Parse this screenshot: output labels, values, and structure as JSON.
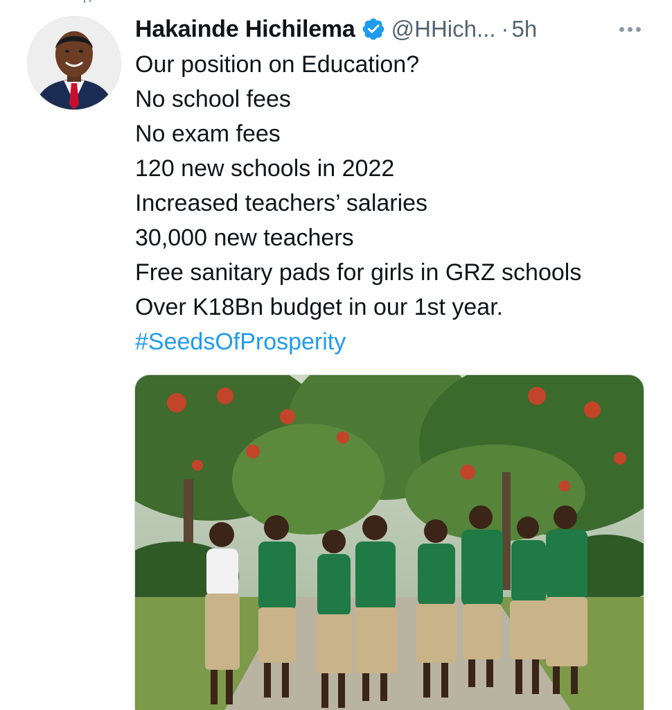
{
  "tweet": {
    "author_name": "Hakainde Hichilema",
    "handle": "@HHich...",
    "separator": "·",
    "time": "5h",
    "lines": [
      "Our position on Education?",
      "No school fees",
      "No exam fees",
      "120 new schools in 2022",
      "Increased teachers’ salaries",
      "30,000 new teachers",
      "Free sanitary pads for girls in GRZ schools",
      "Over K18Bn budget in our 1st year."
    ],
    "hashtag": "#SeedsOfProsperity"
  },
  "icons": {
    "verified": "verified-badge-icon",
    "more": "more-options-icon"
  },
  "colors": {
    "accent": "#1d9bf0",
    "secondary_text": "#536471",
    "primary_text": "#0f1419",
    "uniform_green": "#1f7a46",
    "skirt_khaki": "#c9b48a"
  }
}
